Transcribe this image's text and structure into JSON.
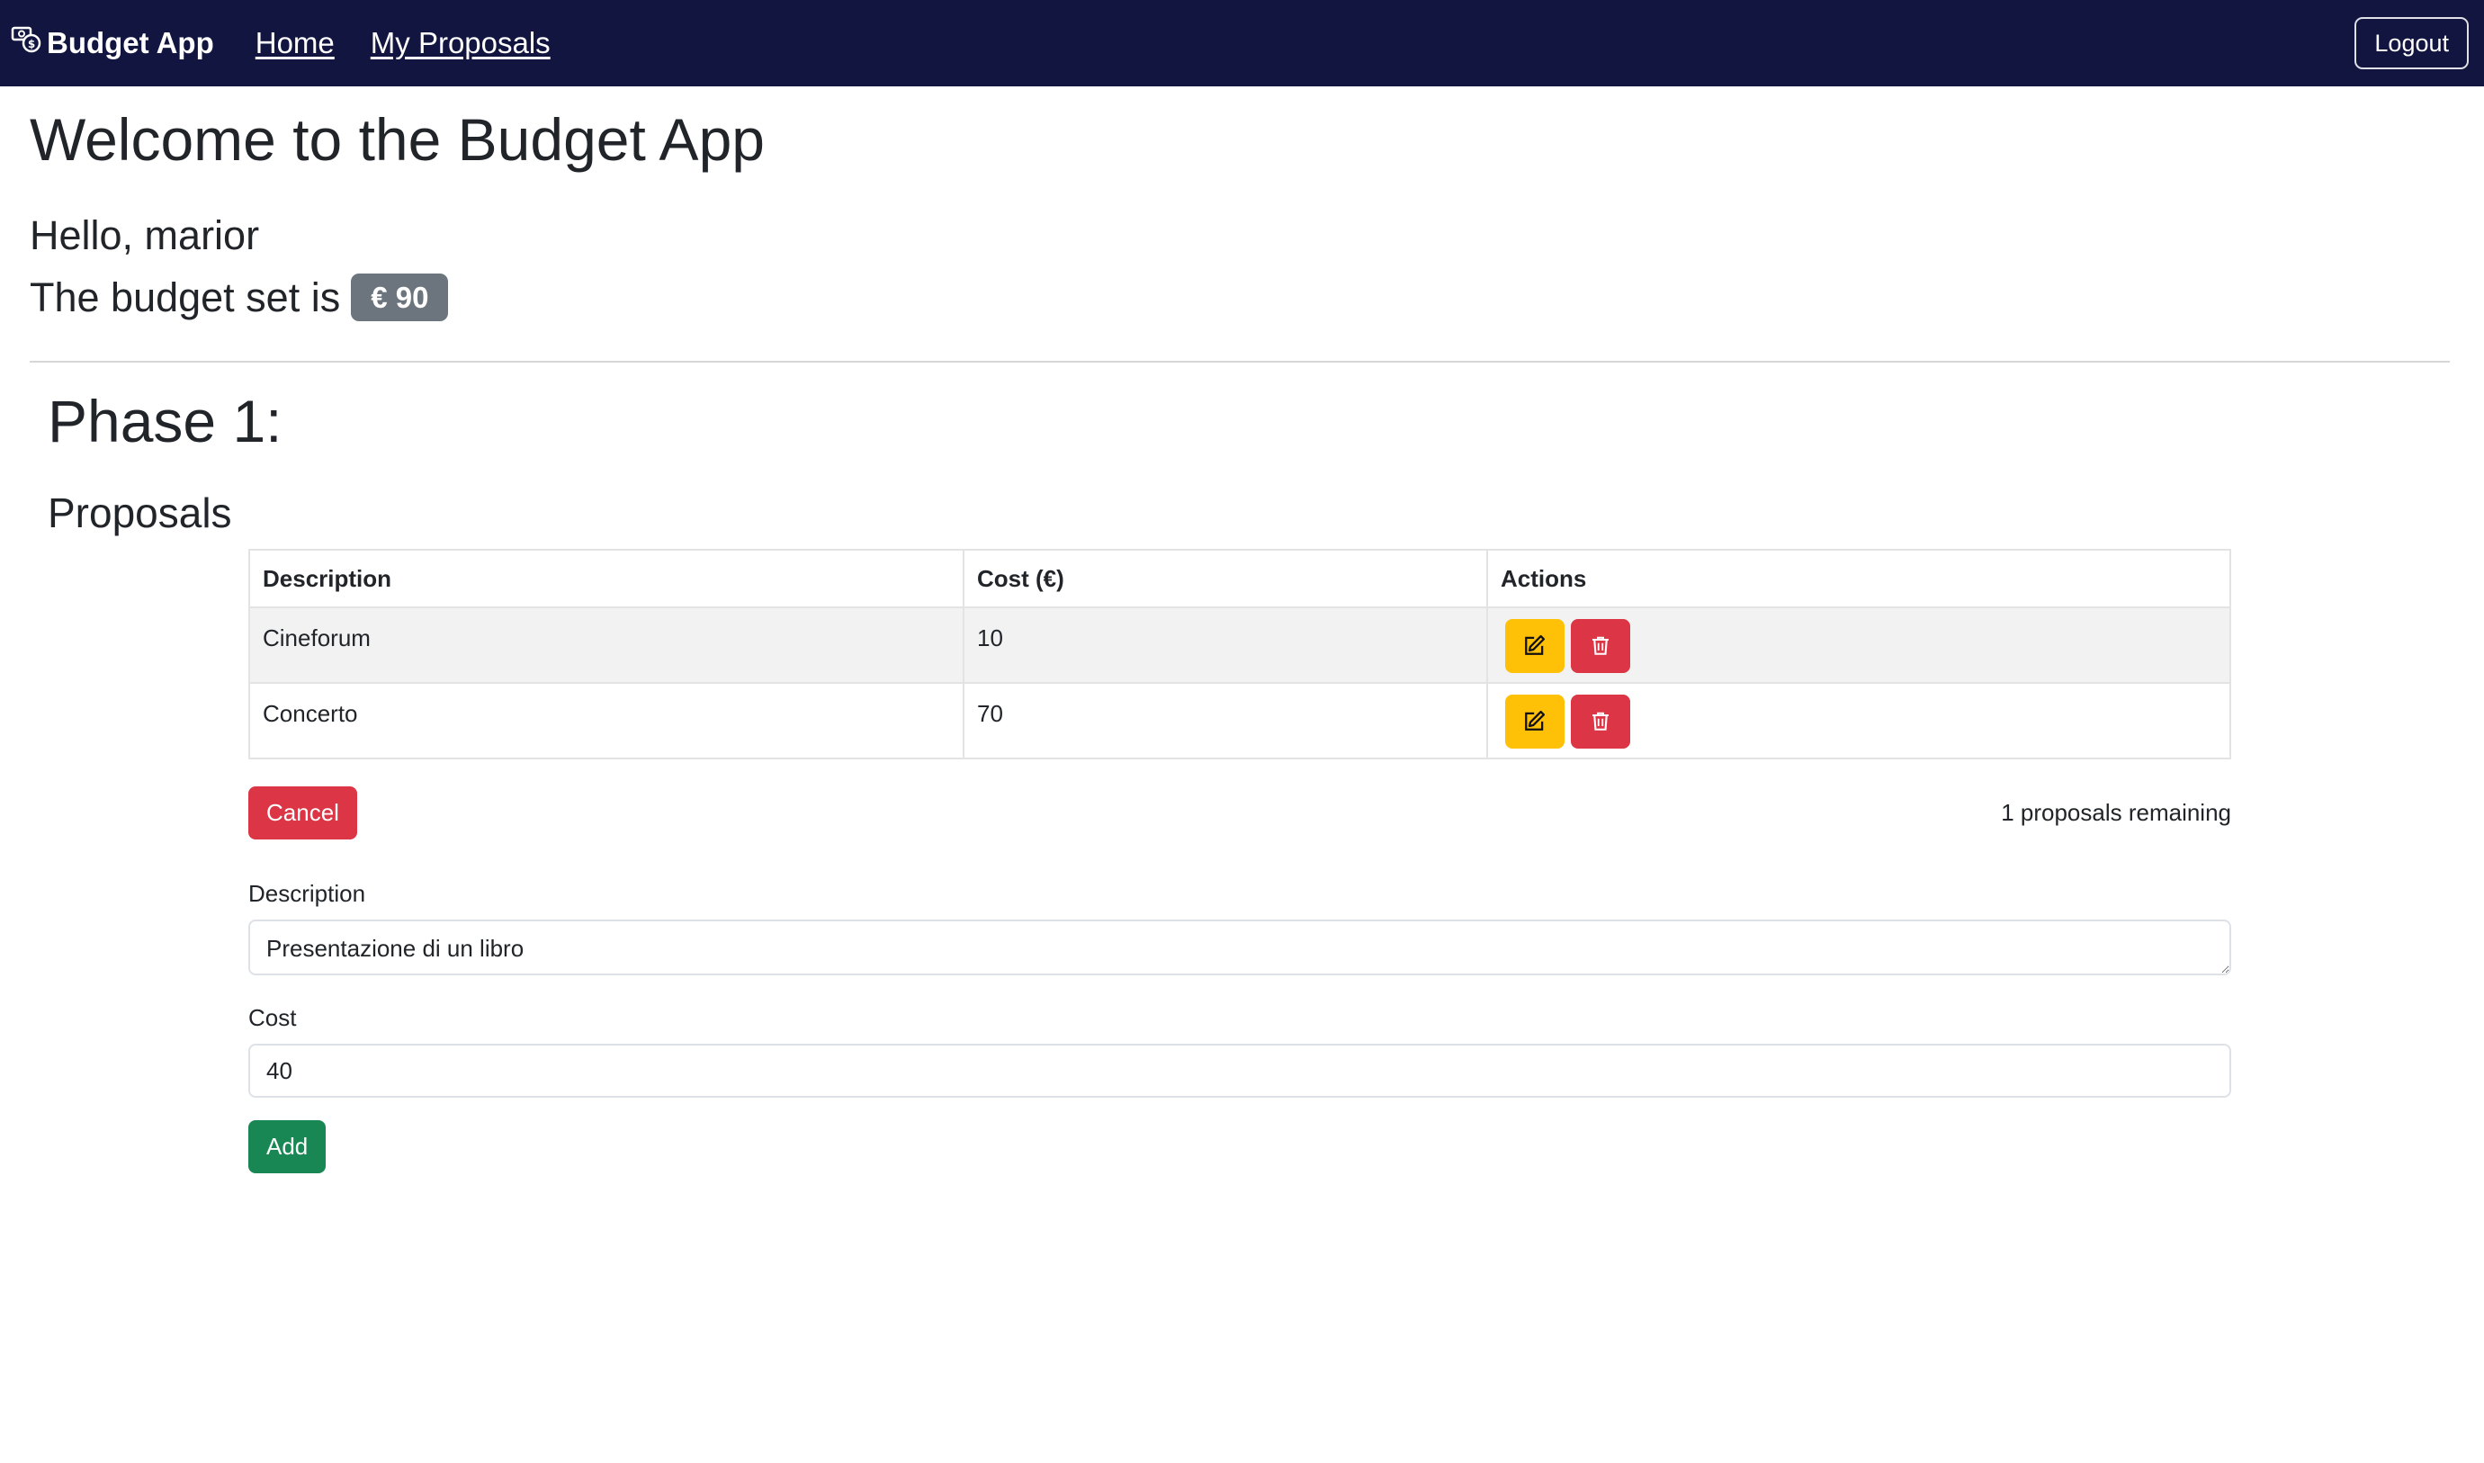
{
  "navbar": {
    "brand": "Budget App",
    "brand_icon": "money-cash-icon",
    "links": [
      "Home",
      "My Proposals"
    ],
    "logout_label": "Logout",
    "background": "#12153f"
  },
  "main": {
    "title": "Welcome to the Budget App",
    "greeting": "Hello, marior",
    "budget_text": "The budget set is",
    "budget_value": "€ 90",
    "phase_title": "Phase 1:",
    "proposals_title": "Proposals"
  },
  "table": {
    "headers": [
      "Description",
      "Cost (€)",
      "Actions"
    ],
    "rows": [
      {
        "description": "Cineforum",
        "cost": "10"
      },
      {
        "description": "Concerto",
        "cost": "70"
      }
    ],
    "action_icons": [
      "edit-icon",
      "trash-icon"
    ]
  },
  "controls": {
    "cancel_label": "Cancel",
    "remaining_text": "1 proposals remaining"
  },
  "form": {
    "description_label": "Description",
    "description_value": "Presentazione di un libro",
    "cost_label": "Cost",
    "cost_value": "40",
    "add_label": "Add"
  },
  "colors": {
    "warning": "#ffc107",
    "danger": "#dc3545",
    "success": "#198754",
    "badge": "#6c757d"
  }
}
